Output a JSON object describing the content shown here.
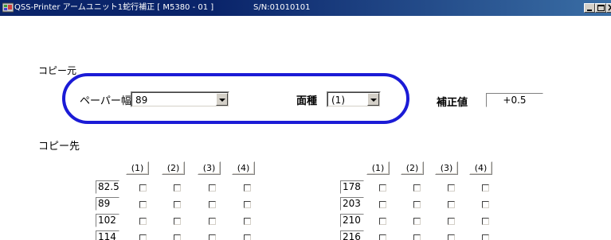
{
  "window": {
    "title": "QSS-Printer アームユニット1蛇行補正 [ M5380 - 01 ]",
    "serial": "S/N:01010101"
  },
  "copy_source": {
    "label": "コピー元",
    "paper_width_label": "ペーパー幅",
    "paper_width_value": "89",
    "face_label": "面種",
    "face_value": "(1)",
    "correction_label": "補正値",
    "correction_value": "+0.5"
  },
  "copy_dest": {
    "label": "コピー先",
    "columns": [
      "(1)",
      "(2)",
      "(3)",
      "(4)"
    ],
    "left_rows": [
      "82.5",
      "89",
      "102",
      "114"
    ],
    "right_rows": [
      "178",
      "203",
      "210",
      "216"
    ]
  },
  "colors": {
    "title_bar": "#0a246a",
    "highlight": "#1b1bd6"
  },
  "icons": [
    "app-icon",
    "minimize-icon",
    "maximize-icon",
    "close-icon",
    "dropdown-arrow-icon"
  ]
}
